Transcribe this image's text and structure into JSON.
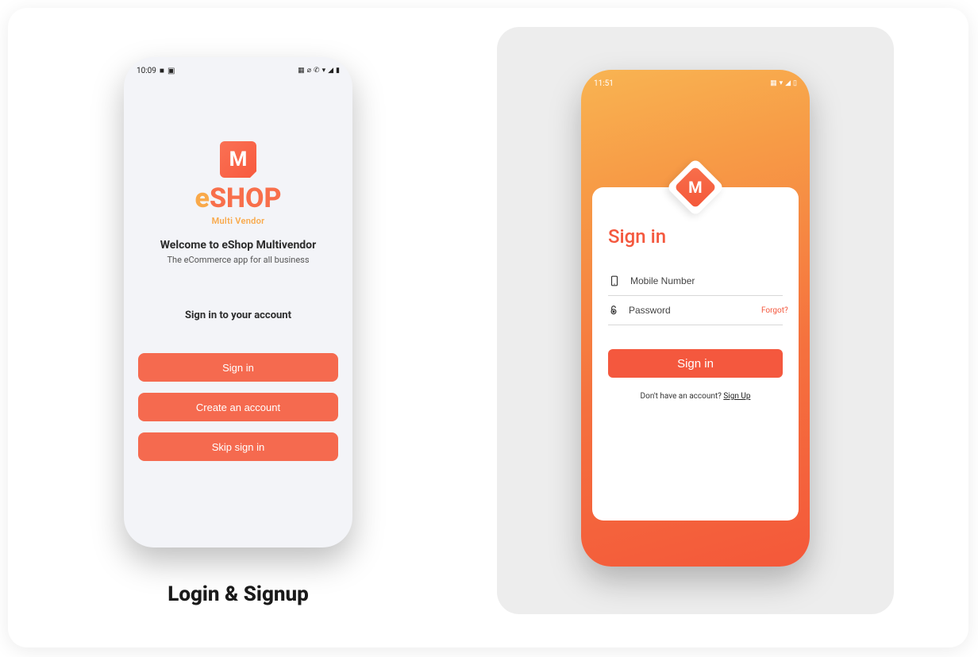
{
  "caption": "Login & Signup",
  "left": {
    "status_time": "10:09",
    "logo_main_e": "e",
    "logo_main_rest": "SHOP",
    "logo_glyph": "M",
    "logo_sub": "Multi Vendor",
    "welcome_title": "Welcome to eShop Multivendor",
    "welcome_sub": "The eCommerce app for all business",
    "signin_prompt": "Sign in to your account",
    "buttons": {
      "signin": "Sign in",
      "create": "Create an account",
      "skip": "Skip sign in"
    }
  },
  "right": {
    "status_time": "11:51",
    "logo_glyph": "M",
    "title": "Sign in",
    "mobile_placeholder": "Mobile Number",
    "password_placeholder": "Password",
    "forgot": "Forgot?",
    "signin_btn": "Sign in",
    "no_account_text": "Don't have an account? ",
    "signup_link": "Sign Up"
  }
}
